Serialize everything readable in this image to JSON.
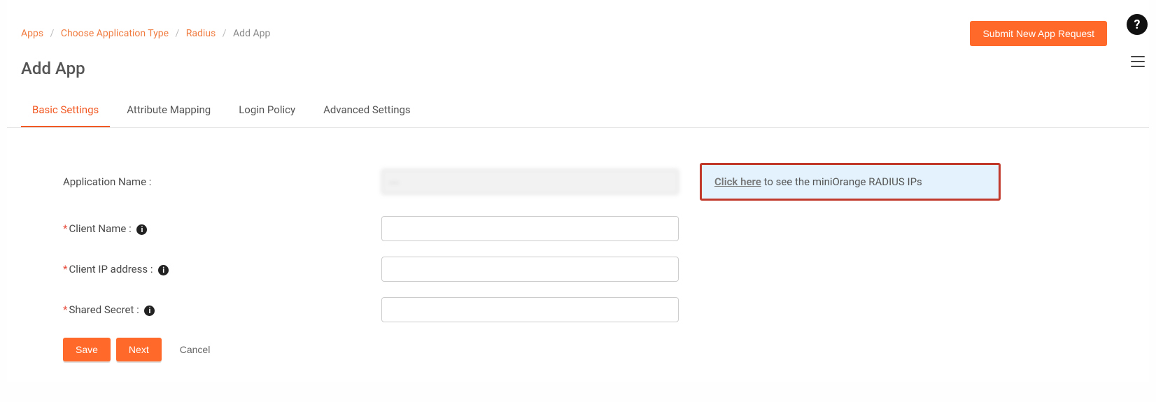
{
  "breadcrumbs": {
    "items": [
      {
        "label": "Apps",
        "link": true
      },
      {
        "label": "Choose Application Type",
        "link": true
      },
      {
        "label": "Radius",
        "link": true
      },
      {
        "label": "Add App",
        "link": false
      }
    ]
  },
  "header": {
    "submit_button": "Submit New App Request",
    "title": "Add App"
  },
  "tabs": [
    {
      "label": "Basic Settings",
      "active": true
    },
    {
      "label": "Attribute Mapping",
      "active": false
    },
    {
      "label": "Login Policy",
      "active": false
    },
    {
      "label": "Advanced Settings",
      "active": false
    }
  ],
  "form": {
    "app_name_label": "Application Name :",
    "app_name_value": "—",
    "client_name_label": "Client Name :",
    "client_name_value": "",
    "client_ip_label": "Client IP address :",
    "client_ip_value": "",
    "shared_secret_label": "Shared Secret :",
    "shared_secret_value": ""
  },
  "info_panel": {
    "link_text": "Click here",
    "rest_text": " to see the miniOrange RADIUS IPs"
  },
  "actions": {
    "save": "Save",
    "next": "Next",
    "cancel": "Cancel"
  }
}
